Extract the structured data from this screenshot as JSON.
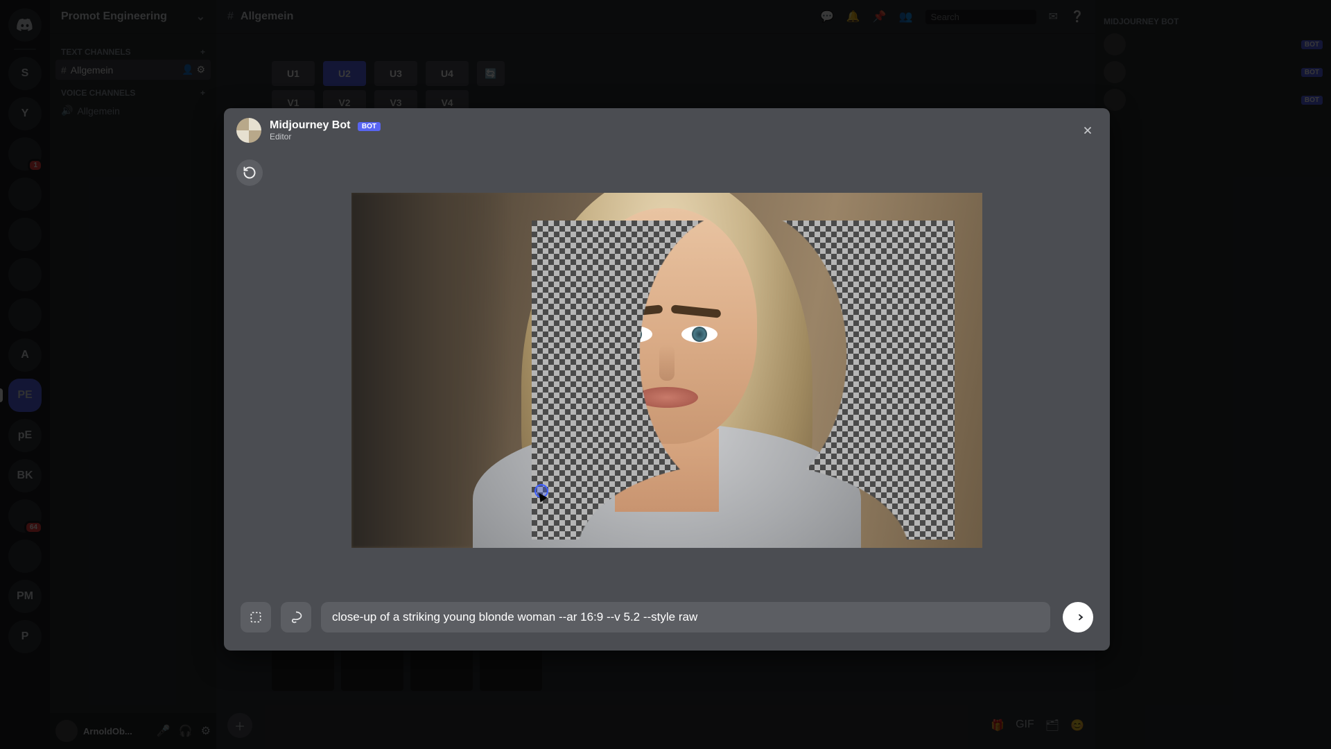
{
  "server": {
    "name": "Promot Engineering"
  },
  "channelCategories": {
    "cat1": "TEXT CHANNELS",
    "cat2": "VOICE CHANNELS"
  },
  "channels": {
    "allgemein": "Allgemein",
    "allgemein2": "Allgemein"
  },
  "userPanel": {
    "name": "ArnoldOb..."
  },
  "chatHeader": {
    "channel": "Allgemein"
  },
  "searchPlaceholder": "Search",
  "upscale": {
    "u1": "U1",
    "u2": "U2",
    "u3": "U3",
    "u4": "U4",
    "v1": "V1",
    "v2": "V2",
    "v3": "V3",
    "v4": "V4"
  },
  "modal": {
    "botName": "Midjourney Bot",
    "botTag": "BOT",
    "subtitle": "Editor",
    "prompt": "close-up of a striking young blonde woman --ar 16:9 --v 5.2 --style raw"
  },
  "members": {
    "category": "MIDJOURNEY BOT"
  }
}
